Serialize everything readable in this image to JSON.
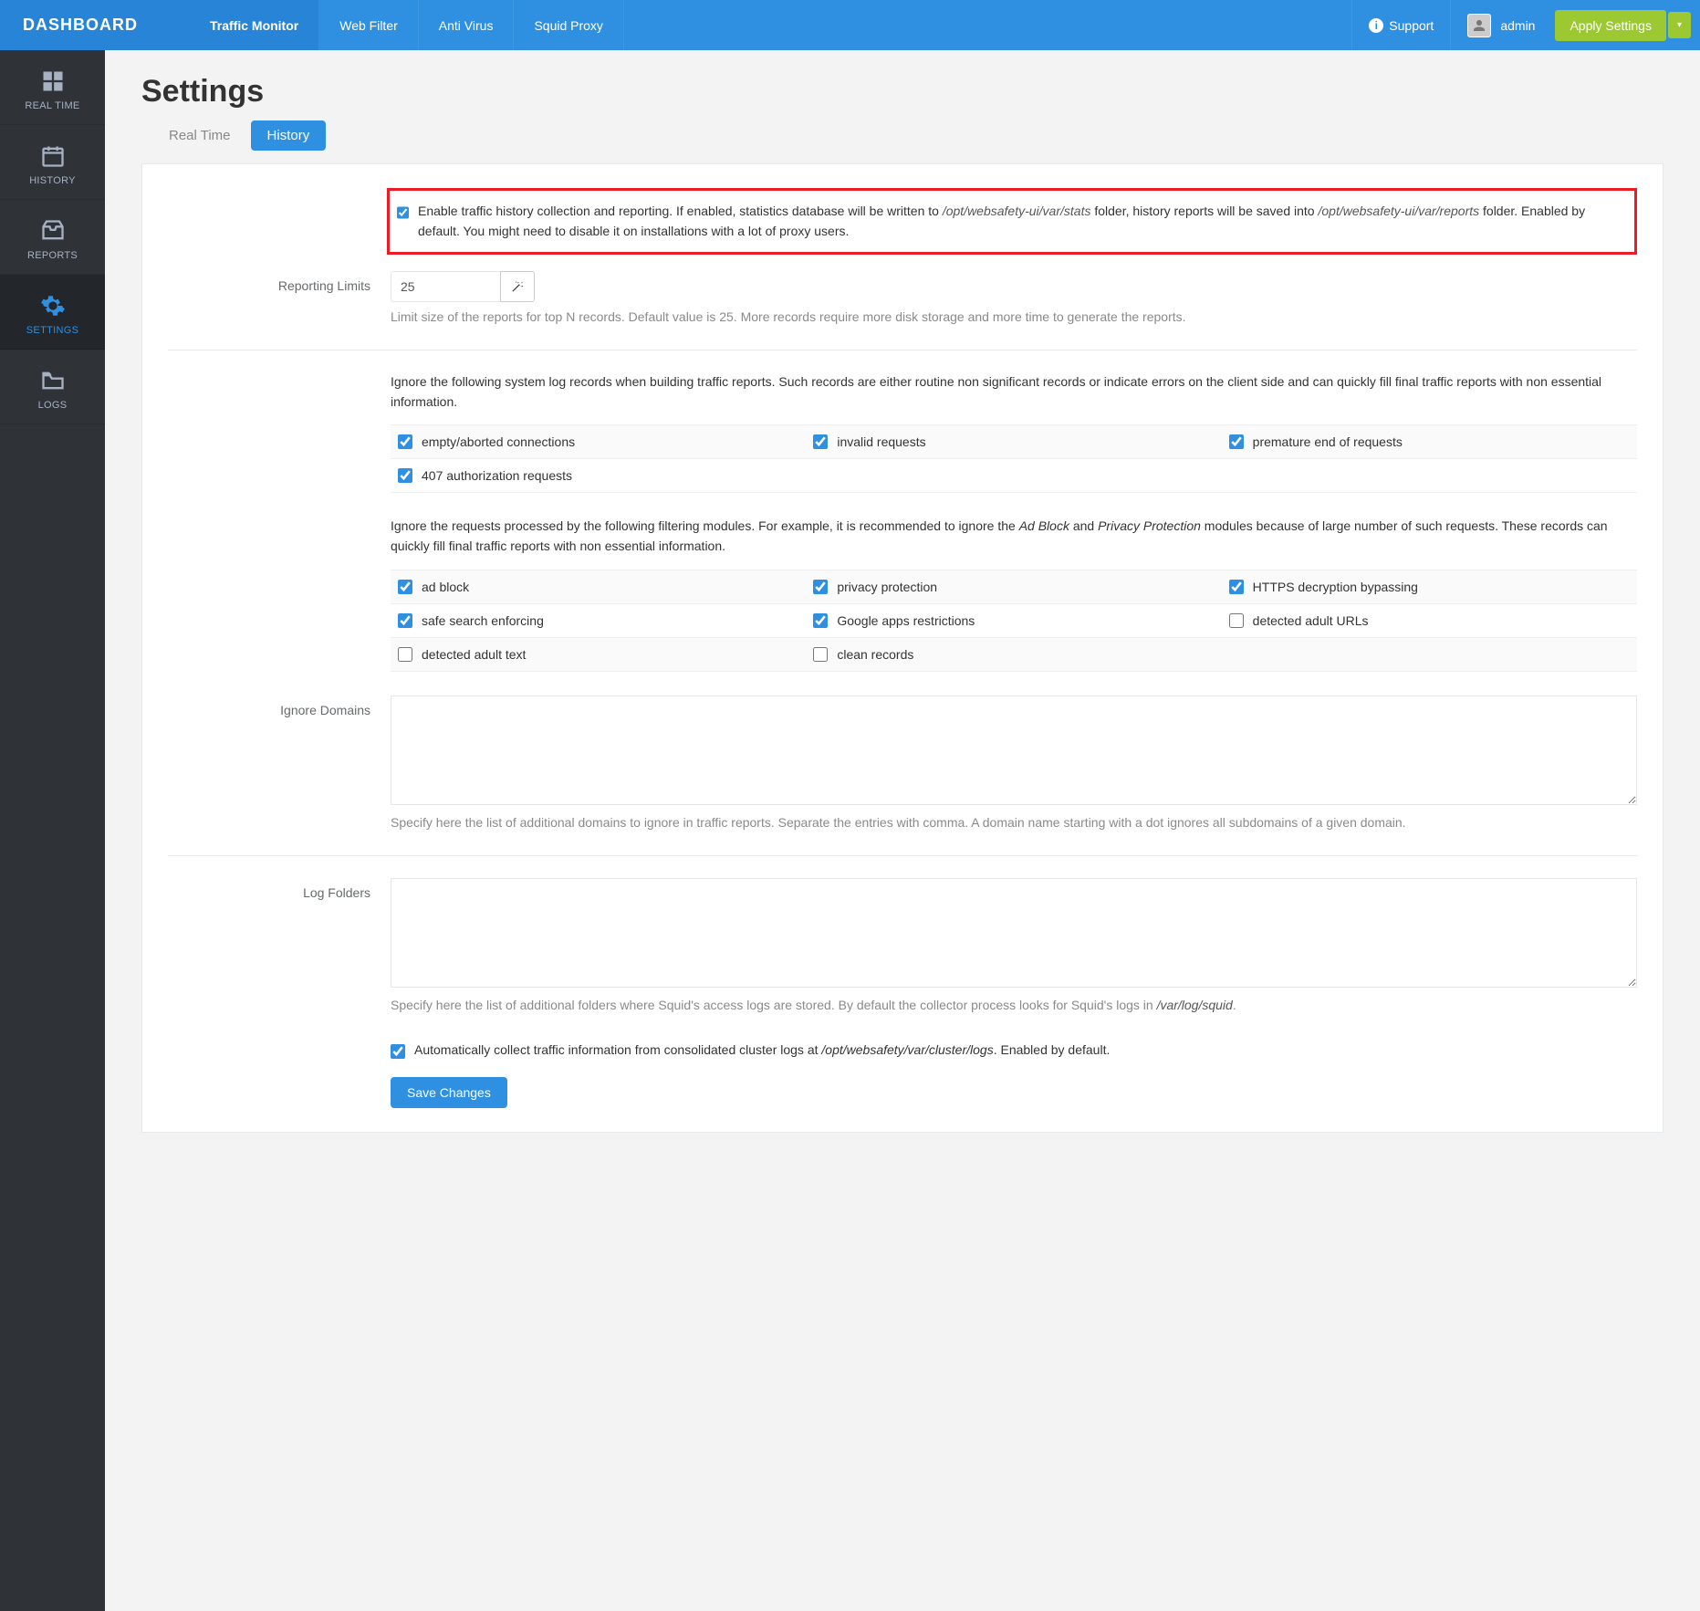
{
  "brand": "DASHBOARD",
  "topTabs": [
    "Traffic Monitor",
    "Web Filter",
    "Anti Virus",
    "Squid Proxy"
  ],
  "activeTopTab": 0,
  "support": "Support",
  "user": "admin",
  "applyBtn": "Apply Settings",
  "sidebar": [
    {
      "icon": "grid",
      "label": "REAL TIME"
    },
    {
      "icon": "calendar",
      "label": "HISTORY"
    },
    {
      "icon": "inbox",
      "label": "REPORTS"
    },
    {
      "icon": "gear",
      "label": "SETTINGS"
    },
    {
      "icon": "folder",
      "label": "LOGS"
    }
  ],
  "activeSidebar": 3,
  "page": {
    "title": "Settings",
    "tabs": [
      "Real Time",
      "History"
    ],
    "activeTab": 1
  },
  "enable": {
    "checked": true,
    "text_pre": "Enable traffic history collection and reporting. If enabled, statistics database will be written to ",
    "path1": "/opt/websafety-ui/var/stats",
    "text_mid": " folder, history reports will be saved into ",
    "path2": "/opt/websafety-ui/var/reports",
    "text_post": " folder. Enabled by default. You might need to disable it on installations with a lot of proxy users."
  },
  "reporting": {
    "label": "Reporting Limits",
    "value": "25",
    "help": "Limit size of the reports for top N records. Default value is 25. More records require more disk storage and more time to generate the reports."
  },
  "ignoreSys": {
    "intro": "Ignore the following system log records when building traffic reports. Such records are either routine non significant records or indicate errors on the client side and can quickly fill final traffic reports with non essential information.",
    "items": [
      {
        "label": "empty/aborted connections",
        "checked": true
      },
      {
        "label": "invalid requests",
        "checked": true
      },
      {
        "label": "premature end of requests",
        "checked": true
      },
      {
        "label": "407 authorization requests",
        "checked": true
      }
    ]
  },
  "ignoreMod": {
    "intro_pre": "Ignore the requests processed by the following filtering modules. For example, it is recommended to ignore the ",
    "em1": "Ad Block",
    "intro_mid": " and ",
    "em2": "Privacy Protection",
    "intro_post": " modules because of large number of such requests. These records can quickly fill final traffic reports with non essential information.",
    "items": [
      {
        "label": "ad block",
        "checked": true
      },
      {
        "label": "privacy protection",
        "checked": true
      },
      {
        "label": "HTTPS decryption bypassing",
        "checked": true
      },
      {
        "label": "safe search enforcing",
        "checked": true
      },
      {
        "label": "Google apps restrictions",
        "checked": true
      },
      {
        "label": "detected adult URLs",
        "checked": false
      },
      {
        "label": "detected adult text",
        "checked": false
      },
      {
        "label": "clean records",
        "checked": false
      }
    ]
  },
  "ignoreDomains": {
    "label": "Ignore Domains",
    "value": "",
    "help": "Specify here the list of additional domains to ignore in traffic reports. Separate the entries with comma. A domain name starting with a dot ignores all subdomains of a given domain."
  },
  "logFolders": {
    "label": "Log Folders",
    "value": "",
    "help_pre": "Specify here the list of additional folders where Squid's access logs are stored. By default the collector process looks for Squid's logs in ",
    "help_em": "/var/log/squid",
    "help_post": "."
  },
  "autoCollect": {
    "checked": true,
    "text_pre": "Automatically collect traffic information from consolidated cluster logs at ",
    "path": "/opt/websafety/var/cluster/logs",
    "text_post": ". Enabled by default."
  },
  "saveBtn": "Save Changes"
}
